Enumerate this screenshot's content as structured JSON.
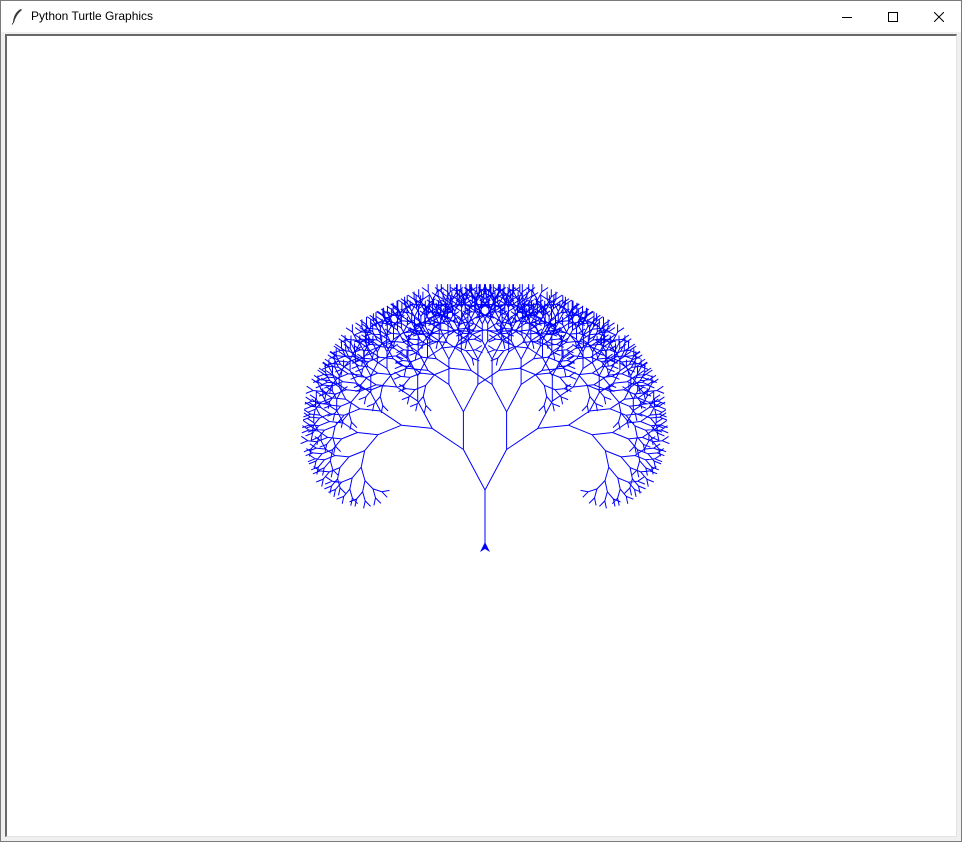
{
  "window": {
    "title": "Python Turtle Graphics",
    "controls": {
      "minimize_icon": "minimize-icon",
      "maximize_icon": "maximize-icon",
      "close_icon": "close-icon"
    }
  },
  "canvas": {
    "background": "#ffffff",
    "pen_color": "#0000ff",
    "drawing": "fractal-tree",
    "turtle_icon": "turtle-arrow-icon",
    "turtle_heading": "up"
  }
}
